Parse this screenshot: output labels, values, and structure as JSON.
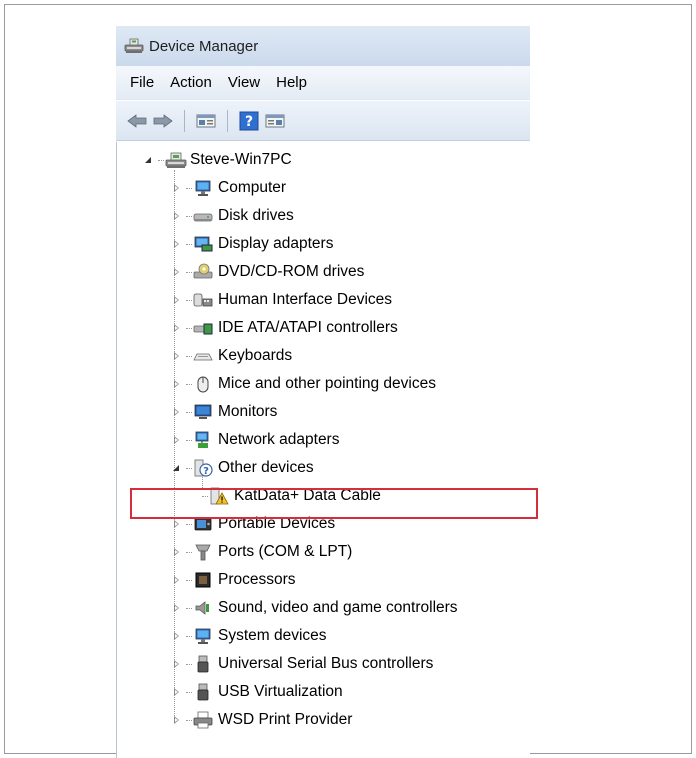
{
  "window": {
    "title": "Device Manager"
  },
  "menu": [
    "File",
    "Action",
    "View",
    "Help"
  ],
  "toolbar": {
    "buttons": [
      "back-arrow-icon",
      "forward-arrow-icon",
      "properties-pane-icon",
      "help-icon",
      "show-pane-icon"
    ]
  },
  "tree": {
    "root": "Steve-Win7PC",
    "categories": [
      {
        "label": "Computer",
        "icon": "computer-icon"
      },
      {
        "label": "Disk drives",
        "icon": "disk-drive-icon"
      },
      {
        "label": "Display adapters",
        "icon": "display-adapter-icon"
      },
      {
        "label": "DVD/CD-ROM drives",
        "icon": "dvd-drive-icon"
      },
      {
        "label": "Human Interface Devices",
        "icon": "hid-icon"
      },
      {
        "label": "IDE ATA/ATAPI controllers",
        "icon": "ide-controller-icon"
      },
      {
        "label": "Keyboards",
        "icon": "keyboard-icon"
      },
      {
        "label": "Mice and other pointing devices",
        "icon": "mouse-icon"
      },
      {
        "label": "Monitors",
        "icon": "monitor-icon"
      },
      {
        "label": "Network adapters",
        "icon": "network-adapter-icon"
      },
      {
        "label": "Other devices",
        "icon": "unknown-device-icon"
      },
      {
        "label": "KatData+ Data Cable",
        "icon": "warning-device-icon"
      },
      {
        "label": "Portable Devices",
        "icon": "portable-device-icon"
      },
      {
        "label": "Ports (COM & LPT)",
        "icon": "port-icon"
      },
      {
        "label": "Processors",
        "icon": "processor-icon"
      },
      {
        "label": "Sound, video and game controllers",
        "icon": "sound-icon"
      },
      {
        "label": "System devices",
        "icon": "system-device-icon"
      },
      {
        "label": "Universal Serial Bus controllers",
        "icon": "usb-icon"
      },
      {
        "label": "USB Virtualization",
        "icon": "usb-icon"
      },
      {
        "label": "WSD Print Provider",
        "icon": "printer-icon"
      }
    ]
  },
  "colors": {
    "highlight_border": "#d62d3a",
    "titlebar": "#cad9ec"
  }
}
